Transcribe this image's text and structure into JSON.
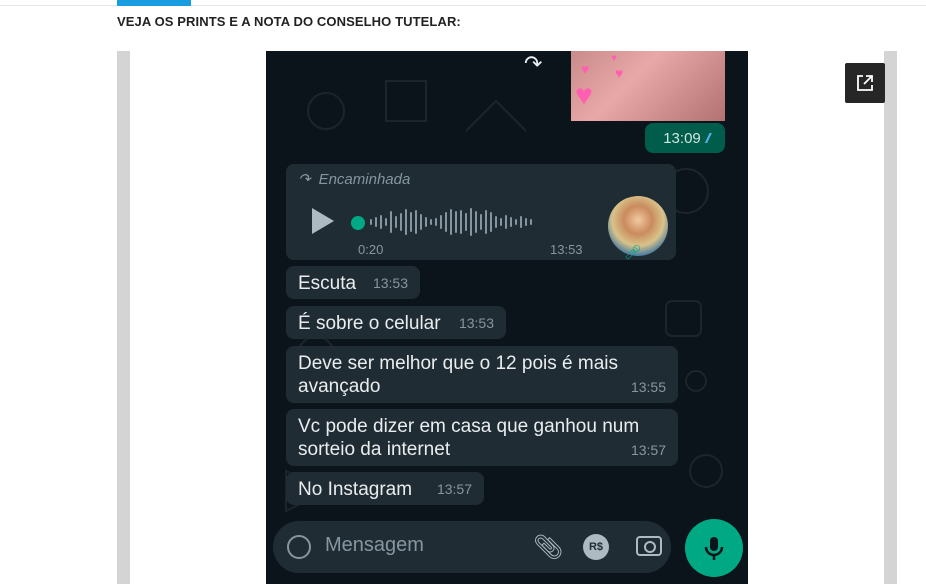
{
  "heading": "VEJA OS PRINTS E A NOTA DO CONSELHO TUTELAR:",
  "image_message": {
    "time": "13:09"
  },
  "audio": {
    "forward_label": "Encaminhada",
    "duration": "0:20",
    "time": "13:53"
  },
  "messages": [
    {
      "text": "Escuta",
      "time": "13:53"
    },
    {
      "text": "É sobre o celular",
      "time": "13:53"
    },
    {
      "text": "Deve ser melhor que o 12 pois é mais avançado",
      "time": "13:55"
    },
    {
      "text": "Vc pode dizer em casa que ganhou num sorteio da internet",
      "time": "13:57"
    },
    {
      "text": "No Instagram",
      "time": "13:57"
    }
  ],
  "composer": {
    "placeholder": "Mensagem",
    "rs_label": "R$"
  },
  "icons": [
    "open-external-icon",
    "forward-icon",
    "play-icon",
    "mic-icon",
    "emoji-icon",
    "attach-icon",
    "camera-icon"
  ],
  "colors": {
    "accent": "#1a9de0",
    "chat_bg": "#0b141a",
    "bubble_in": "#202c33",
    "bubble_out": "#005c4b",
    "whatsapp_green": "#00a884"
  }
}
